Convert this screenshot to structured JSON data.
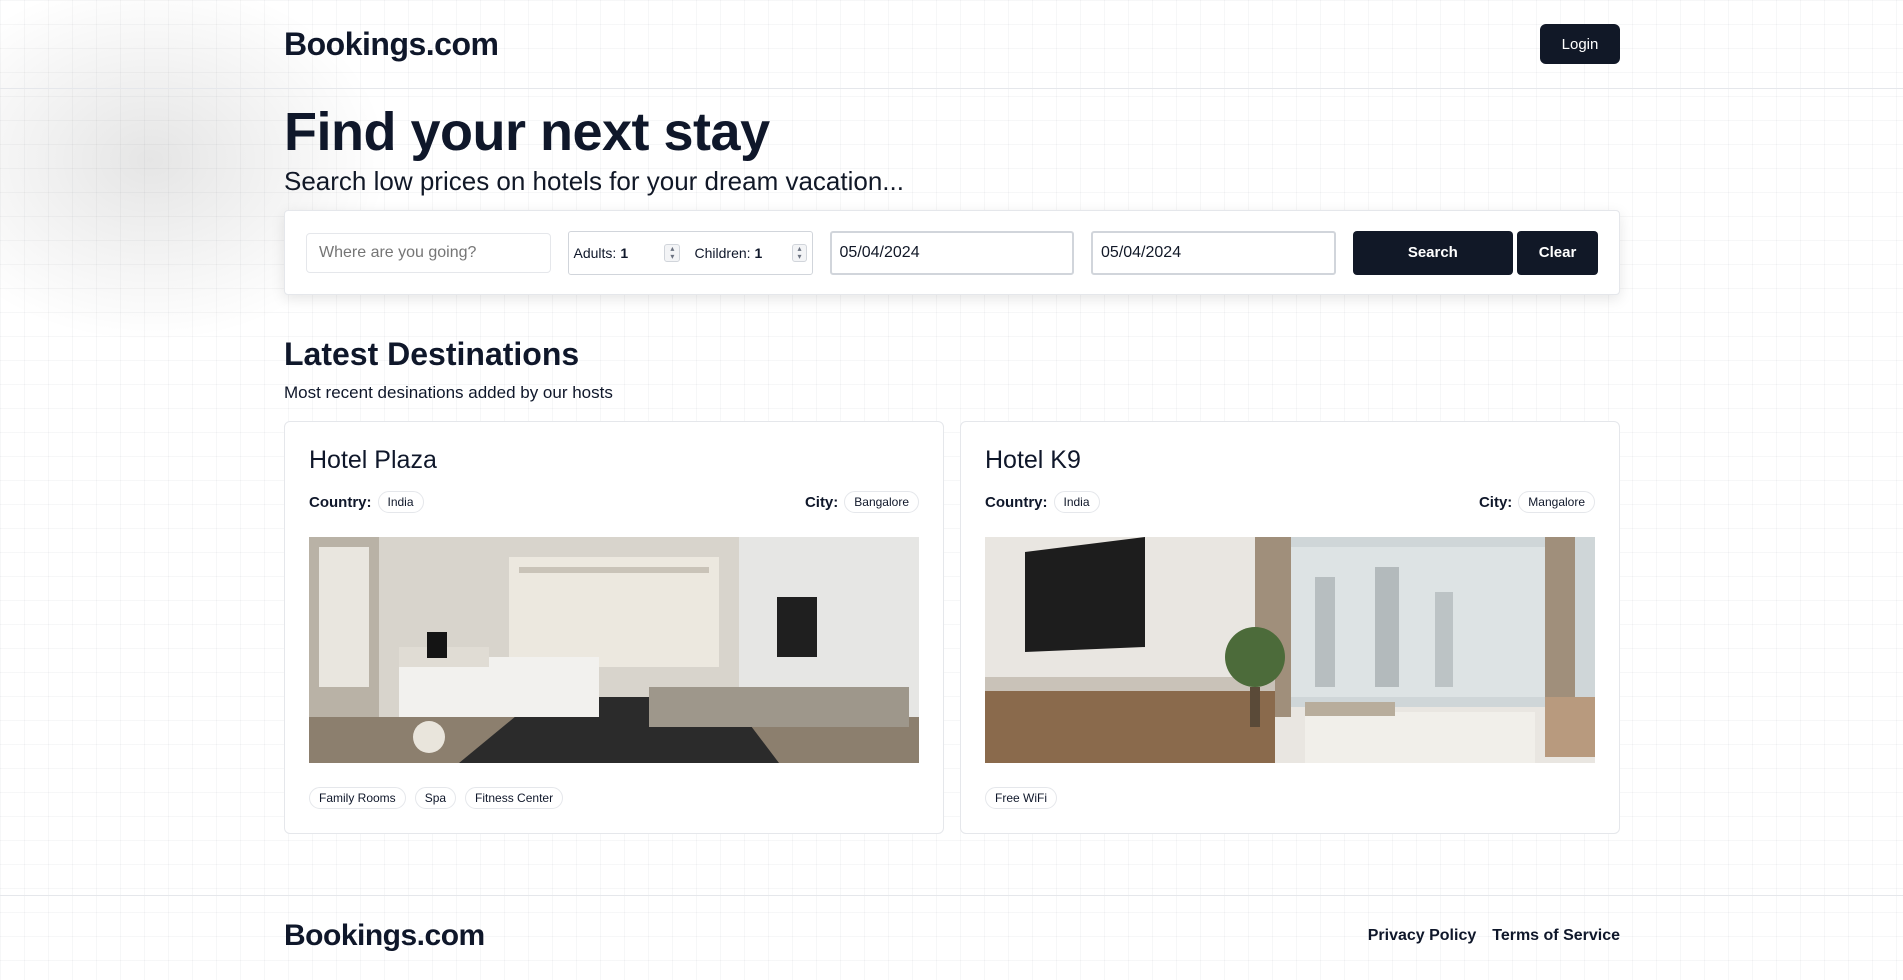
{
  "header": {
    "logo": "Bookings.com",
    "login_label": "Login"
  },
  "hero": {
    "title": "Find your next stay",
    "subtitle": "Search low prices on hotels for your dream vacation..."
  },
  "search": {
    "destination_placeholder": "Where are you going?",
    "adults_label": "Adults:",
    "adults_value": "1",
    "children_label": "Children:",
    "children_value": "1",
    "checkin": "05/04/2024",
    "checkout": "05/04/2024",
    "search_label": "Search",
    "clear_label": "Clear"
  },
  "latest": {
    "title": "Latest Destinations",
    "subtitle": "Most recent desinations added by our hosts",
    "hotels": [
      {
        "name": "Hotel Plaza",
        "country_label": "Country:",
        "country": "India",
        "city_label": "City:",
        "city": "Bangalore",
        "facilities": [
          "Family Rooms",
          "Spa",
          "Fitness Center"
        ]
      },
      {
        "name": "Hotel K9",
        "country_label": "Country:",
        "country": "India",
        "city_label": "City:",
        "city": "Mangalore",
        "facilities": [
          "Free WiFi"
        ]
      }
    ]
  },
  "footer": {
    "logo": "Bookings.com",
    "links": [
      "Privacy Policy",
      "Terms of Service"
    ]
  }
}
